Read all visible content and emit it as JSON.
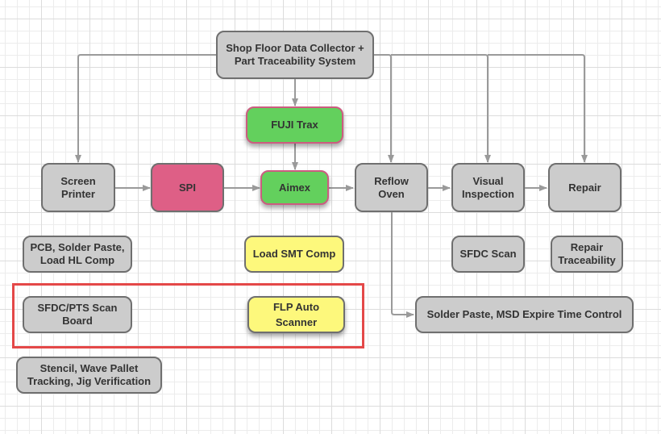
{
  "diagram": {
    "nodes": {
      "sfdc": "Shop Floor Data Collector +\nPart Traceability System",
      "fuji": "FUJI Trax",
      "screen_printer": "Screen\nPrinter",
      "spi": "SPI",
      "aimex": "Aimex",
      "reflow": "Reflow\nOven",
      "visual": "Visual\nInspection",
      "repair": "Repair",
      "pcb": "PCB, Solder Paste,\nLoad HL Comp",
      "load_smt": "Load SMT Comp",
      "sfdc_scan": "SFDC Scan",
      "repair_trace": "Repair\nTraceability",
      "sfdc_pts": "SFDC/PTS Scan\nBoard",
      "flp": "FLP Auto\nScanner",
      "solder_msd": "Solder Paste, MSD Expire Time Control",
      "stencil": "Stencil, Wave Pallet\nTracking,  Jig Verification"
    },
    "edges": [
      [
        "sfdc",
        "screen_printer"
      ],
      [
        "sfdc",
        "fuji"
      ],
      [
        "sfdc",
        "reflow"
      ],
      [
        "sfdc",
        "visual"
      ],
      [
        "sfdc",
        "repair"
      ],
      [
        "fuji",
        "aimex"
      ],
      [
        "screen_printer",
        "spi"
      ],
      [
        "spi",
        "aimex"
      ],
      [
        "aimex",
        "reflow"
      ],
      [
        "reflow",
        "visual"
      ],
      [
        "visual",
        "repair"
      ],
      [
        "reflow",
        "solder_msd"
      ]
    ],
    "highlight": [
      "sfdc_pts",
      "flp"
    ],
    "colors": {
      "default_fill": "#cccccc",
      "spi_fill": "#de5f86",
      "green_fill": "#63d05d",
      "yellow_fill": "#fdf87c",
      "highlight_border": "#e44848",
      "connector": "#9a9a9a"
    }
  }
}
